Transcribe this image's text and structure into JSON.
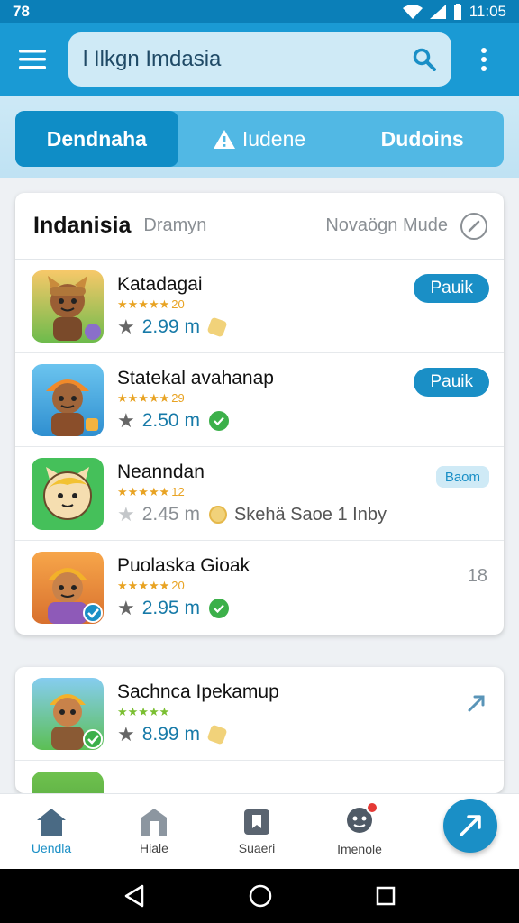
{
  "status_bar": {
    "left": "78",
    "time": "11:05"
  },
  "search": {
    "value": "l Ilkgn Imdasia",
    "placeholder": ""
  },
  "tabs": [
    {
      "label": "Dendnaha",
      "active": true
    },
    {
      "label": "Iudene",
      "active": false,
      "icon": "warning-icon"
    },
    {
      "label": "Dudoins",
      "active": false
    }
  ],
  "card": {
    "title": "Indanisia",
    "subtitle": "Dramyn",
    "mode": "Novaögn Mude",
    "items": [
      {
        "name": "Katadagai",
        "rating": "20",
        "size": "2.99 m",
        "badge": "tag-icon",
        "action": "Pauik",
        "icon_bg": "#f2b35a"
      },
      {
        "name": "Statekal avahanap",
        "rating": "29",
        "size": "2.50 m",
        "badge": "check-icon",
        "action": "Pauik",
        "icon_bg": "#54b7e8"
      },
      {
        "name": "Neanndan",
        "rating": "12",
        "size": "2.45 m",
        "badge": "coin-icon",
        "extra": "Skehä Saoe 1 Inby",
        "action": "Baom",
        "icon_bg": "#45c05a"
      },
      {
        "name": "Puolaska Gioak",
        "rating": "20",
        "size": "2.95 m",
        "badge": "check-icon",
        "count": "18",
        "icon_bg": "#f2803a"
      }
    ]
  },
  "card2": {
    "items": [
      {
        "name": "Sachnca Ipekamup",
        "size": "8.99 m",
        "badge": "tag-icon",
        "icon_bg": "#5cbf54"
      }
    ]
  },
  "bottom_nav": [
    {
      "label": "Uendla",
      "icon": "home-icon",
      "active": true
    },
    {
      "label": "Hiale",
      "icon": "store-icon",
      "active": false
    },
    {
      "label": "Suaeri",
      "icon": "bookmark-icon",
      "active": false
    },
    {
      "label": "Imenole",
      "icon": "profile-icon",
      "active": false
    }
  ],
  "colors": {
    "primary": "#1a9ad4",
    "accent": "#1a8fc6",
    "star": "#e8a323"
  }
}
